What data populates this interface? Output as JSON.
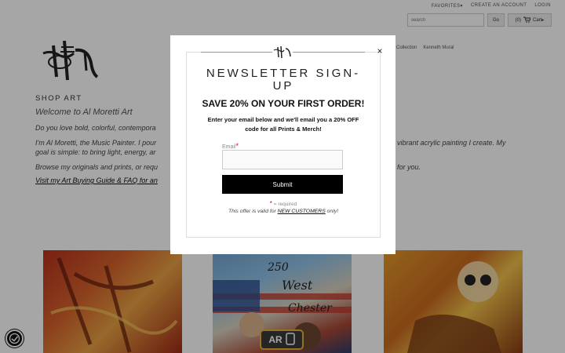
{
  "topnav": {
    "favorites": "FAVORITES▾",
    "create_account": "CREATE AN ACCOUNT",
    "login": "LOGIN"
  },
  "search": {
    "placeholder": "search",
    "go_label": "Go",
    "cart_count": "(0)",
    "cart_label": "Cart▸"
  },
  "mainnav": {
    "items": [
      "Collection",
      "Kenneth Mural"
    ]
  },
  "page": {
    "shop_heading": "SHOP ART",
    "welcome": "Welcome to Al Moretti Art",
    "para1_left": "Do you love bold, colorful, contempora",
    "para2_left": "I'm Al Moretti, the Music Painter. I pour",
    "para2_right": "vibrant acrylic painting I create. My",
    "para2b_left": "goal is simple: to bring light, energy, ar",
    "para3_left": "Browse my originals and prints, or requ",
    "para3_right": "for you.",
    "guide_link": "Visit my Art Buying Guide & FAQ for an"
  },
  "art2_text": {
    "line1": "250",
    "line2": "West",
    "line3": "Chester"
  },
  "ar_badge": {
    "label": "AR"
  },
  "modal": {
    "title": "NEWSLETTER SIGN-UP",
    "offer": "SAVE 20% ON YOUR FIRST ORDER!",
    "desc": "Enter your email below and we'll email you a 20% OFF code for all Prints & Merch!",
    "email_label": "Email",
    "required_star": "*",
    "submit_label": "Submit",
    "required_text": "= required",
    "valid_prefix": "This offer is valid for ",
    "valid_link": "NEW CUSTOMERS",
    "valid_suffix": " only!",
    "close_symbol": "×"
  }
}
